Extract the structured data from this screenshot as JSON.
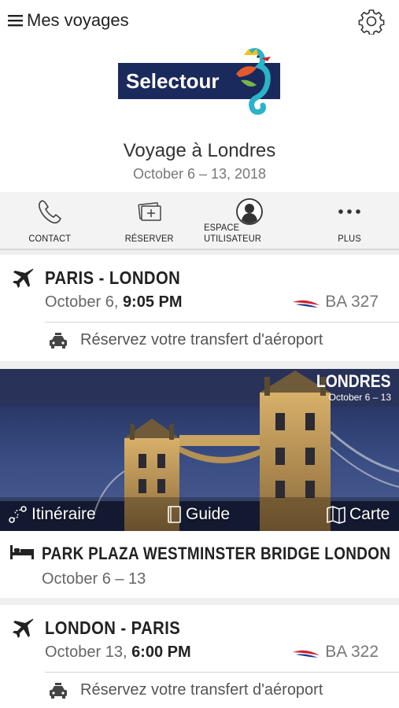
{
  "header": {
    "menu_label": "Mes voyages",
    "logo_text": "Selectour",
    "trip_title": "Voyage à Londres",
    "trip_dates": "October 6 – 13, 2018"
  },
  "toolbar": [
    {
      "label": "CONTACT",
      "icon": "phone-icon"
    },
    {
      "label": "RÉSERVER",
      "icon": "tickets-icon"
    },
    {
      "label": "ESPACE UTILISATEUR",
      "icon": "user-icon"
    },
    {
      "label": "PLUS",
      "icon": "more-icon"
    }
  ],
  "flights": [
    {
      "route": "PARIS - LONDON",
      "date_prefix": "October 6, ",
      "time": "9:05 PM",
      "flight_number": "BA 327",
      "transfer": "Réservez votre transfert d'aéroport"
    },
    {
      "route": "LONDON - PARIS",
      "date_prefix": "October 13, ",
      "time": "6:00 PM",
      "flight_number": "BA 322",
      "transfer": "Réservez votre transfert d'aéroport"
    }
  ],
  "destination": {
    "city": "LONDRES",
    "dates": "October 6 – 13",
    "links": {
      "itinerary": "Itinéraire",
      "guide": "Guide",
      "map": "Carte"
    }
  },
  "hotel": {
    "name": "PARK PLAZA WESTMINSTER BRIDGE LONDON",
    "dates": "October 6 – 13"
  },
  "colors": {
    "logo_bg": "#1b2a5c",
    "ba_red": "#d3202f",
    "ba_blue": "#1a3a8a",
    "icon_gray": "#444444"
  }
}
